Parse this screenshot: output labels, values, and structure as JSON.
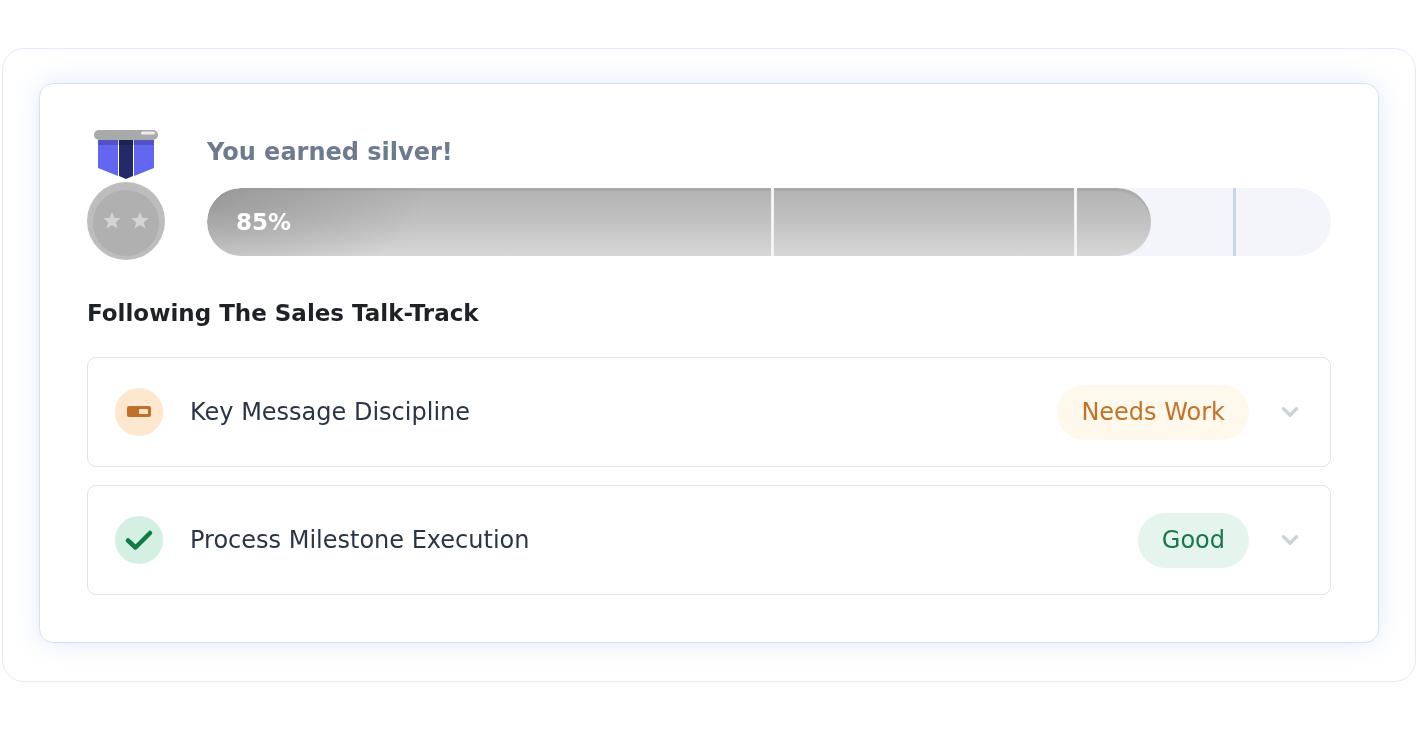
{
  "award": {
    "kind": "silver",
    "title": "You earned silver!"
  },
  "progress": {
    "level": 0.84,
    "reading": "85%"
  },
  "section": {
    "title": "Following The Sales Talk-Track",
    "items": [
      {
        "kind": "warning",
        "label": "Key Message Discipline",
        "status": "Needs Work",
        "expanded": false
      },
      {
        "kind": "good",
        "label": "Process Milestone Execution",
        "status": "Good",
        "expanded": false
      }
    ]
  }
}
